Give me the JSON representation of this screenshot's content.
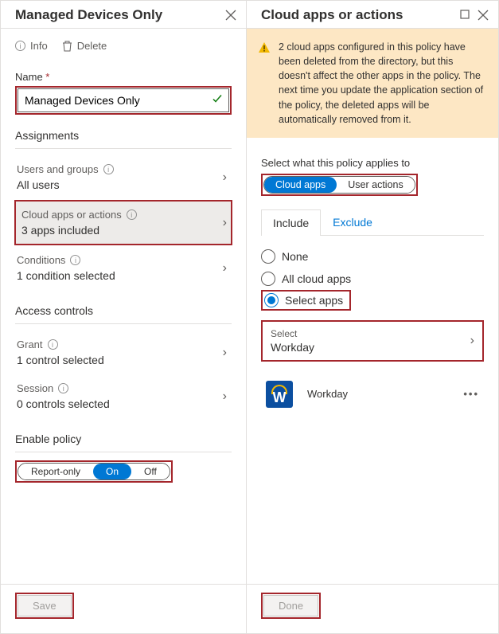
{
  "left": {
    "title": "Managed Devices Only",
    "info_label": "Info",
    "delete_label": "Delete",
    "name_label": "Name",
    "name_value": "Managed Devices Only",
    "assignments_heading": "Assignments",
    "users_row_label": "Users and groups",
    "users_row_value": "All users",
    "apps_row_label": "Cloud apps or actions",
    "apps_row_value": "3 apps included",
    "conditions_row_label": "Conditions",
    "conditions_row_value": "1 condition selected",
    "access_heading": "Access controls",
    "grant_row_label": "Grant",
    "grant_row_value": "1 control selected",
    "session_row_label": "Session",
    "session_row_value": "0 controls selected",
    "enable_heading": "Enable policy",
    "toggle_report": "Report-only",
    "toggle_on": "On",
    "toggle_off": "Off",
    "save_label": "Save"
  },
  "right": {
    "title": "Cloud apps or actions",
    "warning": "2 cloud apps configured in this policy have been deleted from the directory, but this doesn't affect the other apps in the policy. The next time you update the application section of the policy, the deleted apps will be automatically removed from it.",
    "select_label": "Select what this policy applies to",
    "pill_cloud": "Cloud apps",
    "pill_user": "User actions",
    "tab_include": "Include",
    "tab_exclude": "Exclude",
    "radio_none": "None",
    "radio_all": "All cloud apps",
    "radio_select": "Select apps",
    "select_row_label": "Select",
    "select_row_value": "Workday",
    "app_name": "Workday",
    "done_label": "Done"
  }
}
